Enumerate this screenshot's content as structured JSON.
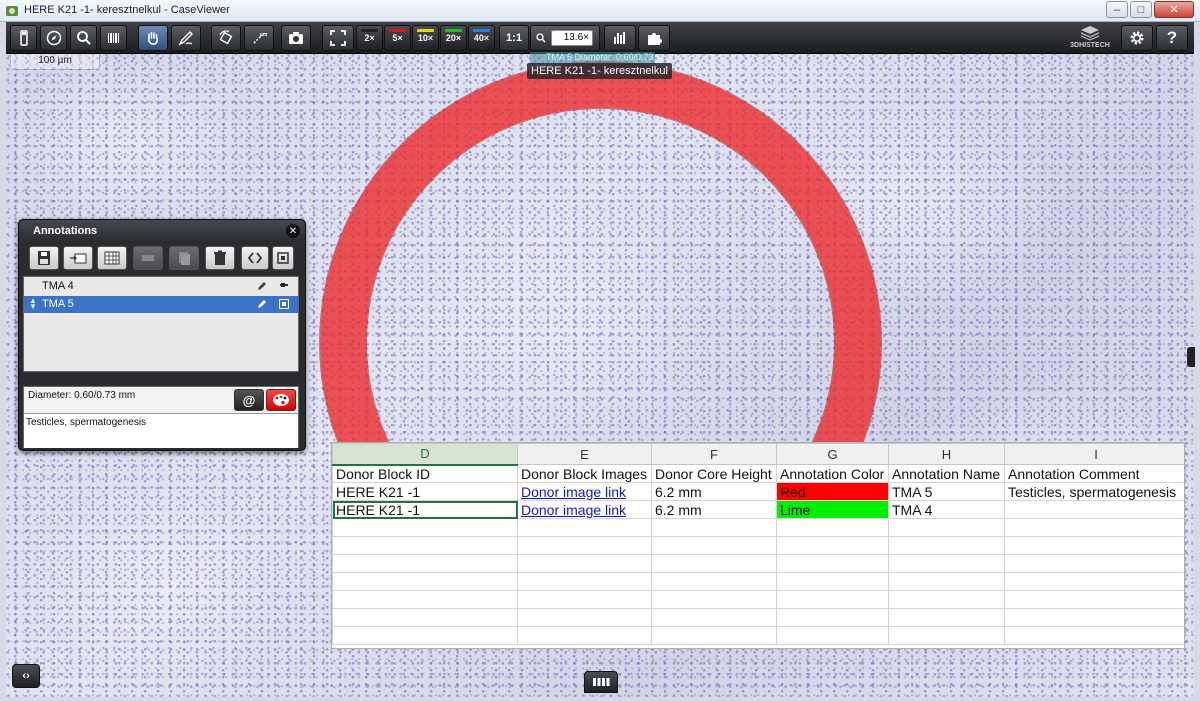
{
  "window": {
    "title": "HERE K21 -1- keresztnelkul - CaseViewer",
    "minimize": "–",
    "maximize": "□",
    "close": "✕"
  },
  "toolbar": {
    "magnifications": [
      "2×",
      "5×",
      "10×",
      "20×",
      "40×"
    ],
    "one_to_one": "1:1",
    "zoom_value": "13.6×",
    "brand": "3DHISTECH",
    "scale_unit": "µm"
  },
  "scale_bar": {
    "label": "100 µm"
  },
  "tooltip": {
    "faint": "TMA 5   Diameter: 0.60/0.73 mm",
    "label": "HERE K21 -1- keresztnelkul"
  },
  "annotations_panel": {
    "title": "Annotations",
    "close": "✕",
    "items": [
      {
        "name": "TMA 4",
        "selected": false
      },
      {
        "name": "TMA 5",
        "selected": true
      }
    ],
    "diameter": "Diameter: 0.60/0.73 mm",
    "comment": "Testicles, spermatogenesis",
    "at_button": "@"
  },
  "spreadsheet": {
    "columns": [
      "D",
      "E",
      "F",
      "G",
      "H",
      "I"
    ],
    "selected_column": "D",
    "header_row": [
      "Donor Block ID",
      "Donor Block Images",
      "Donor Core Height",
      "Annotation Color",
      "Annotation Name",
      "Annotation Comment"
    ],
    "rows": [
      [
        "HERE K21 -1",
        "Donor image link",
        "6.2 mm",
        "Red",
        "TMA 5",
        "Testicles, spermatogenesis"
      ],
      [
        "HERE K21 -1",
        "Donor image link",
        "6.2 mm",
        "Lime",
        "TMA 4",
        ""
      ]
    ],
    "colors": {
      "Red": "#ff0000",
      "Lime": "#00ee00"
    }
  },
  "annotation_ring_color": "#ec2828",
  "nav_arrows": "‹›"
}
